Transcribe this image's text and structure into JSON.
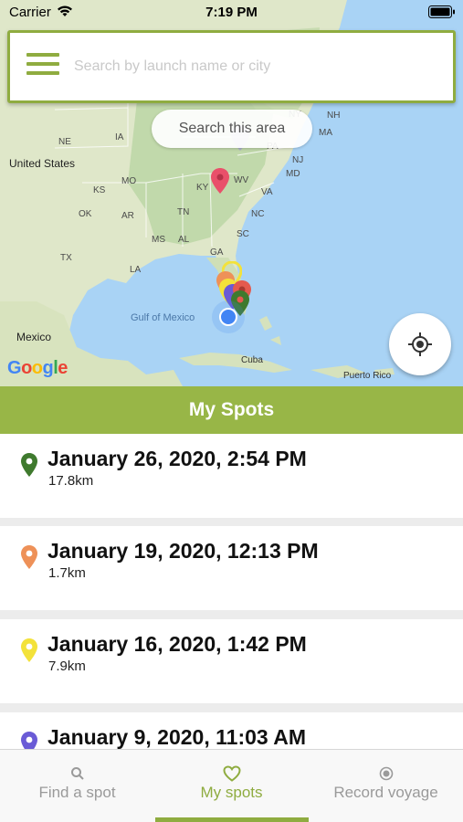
{
  "status_bar": {
    "carrier": "Carrier",
    "time": "7:19 PM"
  },
  "search": {
    "placeholder": "Search by launch name or city",
    "value": ""
  },
  "map": {
    "search_area_label": "Search this area",
    "labels": {
      "united_states": "United States",
      "mexico": "Mexico",
      "gulf": "Gulf of Mexico",
      "cuba": "Cuba",
      "puerto_rico": "Puerto Rico",
      "ne": "NE",
      "ia": "IA",
      "ks": "KS",
      "mo": "MO",
      "ok": "OK",
      "ar": "AR",
      "tx": "TX",
      "la": "LA",
      "ms": "MS",
      "al": "AL",
      "ga": "GA",
      "tn": "TN",
      "ky": "KY",
      "wv": "WV",
      "va": "VA",
      "nc": "NC",
      "sc": "SC",
      "pa": "PA",
      "ny": "NY",
      "ma": "MA",
      "md": "MD",
      "nj": "NJ",
      "nh": "NH"
    },
    "google": [
      "G",
      "o",
      "o",
      "g",
      "l",
      "e"
    ],
    "colors": {
      "water": "#a9d3f5",
      "land": "#dfe7c9",
      "forest": "#b9d3a4"
    }
  },
  "spots_header": "My Spots",
  "spots": [
    {
      "date": "January 26, 2020, 2:54 PM",
      "distance": "17.8km",
      "pin_color": "#3f7a2e"
    },
    {
      "date": "January 19, 2020, 12:13 PM",
      "distance": "1.7km",
      "pin_color": "#ee9158"
    },
    {
      "date": "January 16, 2020, 1:42 PM",
      "distance": "7.9km",
      "pin_color": "#f3e23a"
    },
    {
      "date": "January 9, 2020, 11:03 AM",
      "distance": "",
      "pin_color": "#6a5bd6"
    }
  ],
  "tabs": [
    {
      "label": "Find a spot",
      "icon": "search-icon",
      "active": false
    },
    {
      "label": "My spots",
      "icon": "heart-icon",
      "active": true
    },
    {
      "label": "Record voyage",
      "icon": "record-icon",
      "active": false
    }
  ],
  "colors": {
    "accent": "#8fac40",
    "header": "#98b647"
  }
}
